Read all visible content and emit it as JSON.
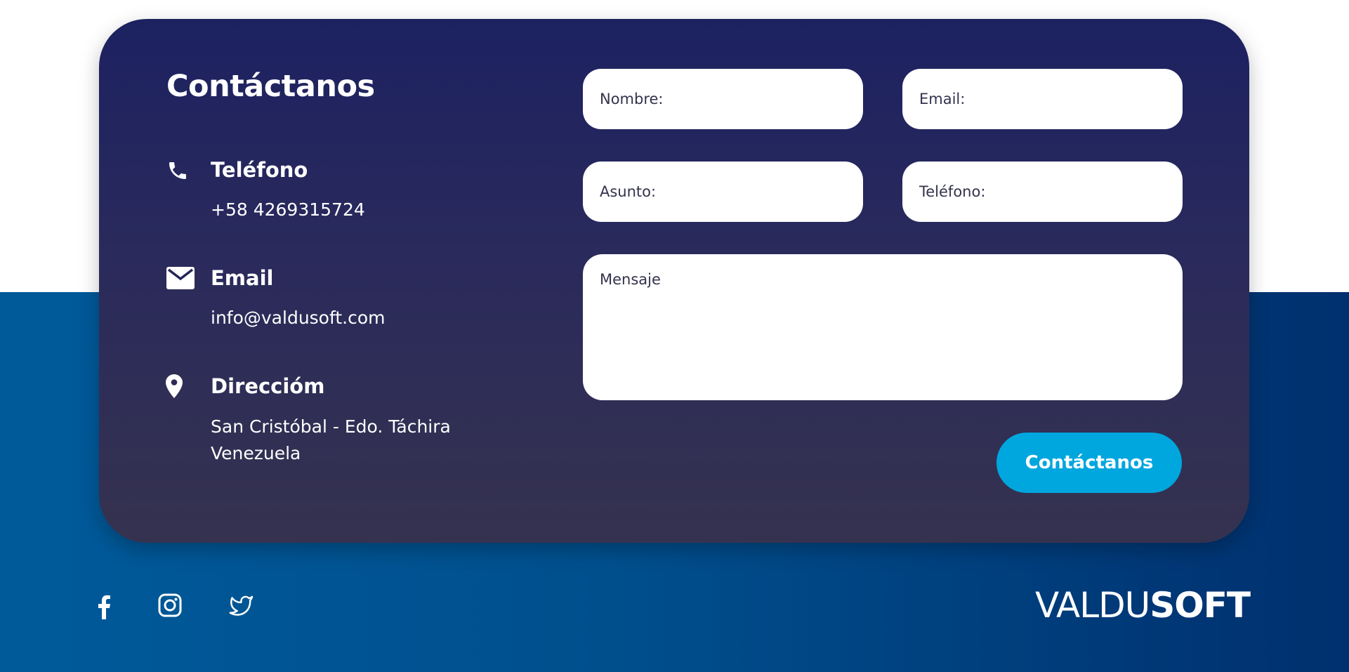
{
  "contact": {
    "title": "Contáctanos",
    "phone": {
      "label": "Teléfono",
      "value": "+58 4269315724",
      "icon": "phone-icon"
    },
    "email": {
      "label": "Email",
      "value": "info@valdusoft.com",
      "icon": "envelope-icon"
    },
    "address": {
      "label": "Direccióm",
      "line1": "San Cristóbal - Edo. Táchira",
      "line2": "Venezuela",
      "icon": "map-pin-icon"
    }
  },
  "form": {
    "name_placeholder": "Nombre:",
    "email_placeholder": "Email:",
    "subject_placeholder": "Asunto:",
    "phone_placeholder": "Teléfono:",
    "message_placeholder": "Mensaje",
    "submit_label": "Contáctanos"
  },
  "footer": {
    "social": [
      "facebook-icon",
      "instagram-icon",
      "twitter-icon"
    ],
    "brand_light": "VALDU",
    "brand_bold": "SOFT"
  },
  "colors": {
    "card_top": "#1c2160",
    "card_bottom": "#35324f",
    "footer_left": "#005a9a",
    "footer_right": "#00306f",
    "accent": "#00a6de"
  }
}
